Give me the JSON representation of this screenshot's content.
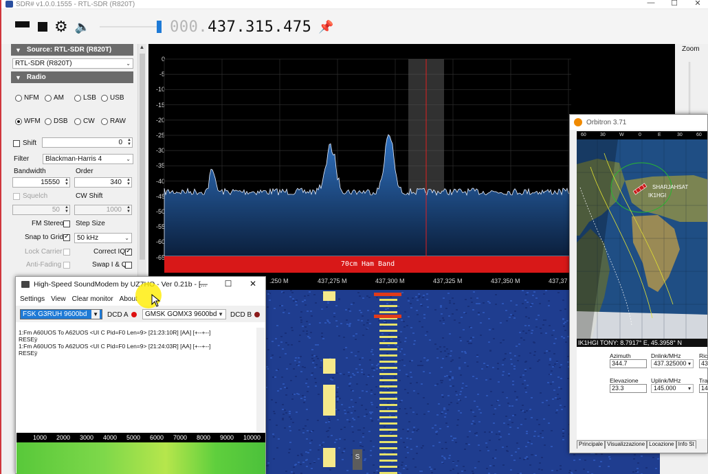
{
  "window": {
    "title": "SDR# v1.0.0.1555 - RTL-SDR (R820T)",
    "controls": [
      "—",
      "☐",
      "✕"
    ]
  },
  "toolbar": {
    "freq_dim": "000.",
    "freq_value": "437.315.475",
    "volume_level": 1.0
  },
  "source": {
    "header": "Source: RTL-SDR (R820T)",
    "device": "RTL-SDR (R820T)"
  },
  "radio": {
    "header": "Radio",
    "modes": [
      {
        "label": "NFM",
        "on": false
      },
      {
        "label": "AM",
        "on": false
      },
      {
        "label": "LSB",
        "on": false
      },
      {
        "label": "USB",
        "on": false
      },
      {
        "label": "WFM",
        "on": true
      },
      {
        "label": "DSB",
        "on": false
      },
      {
        "label": "CW",
        "on": false
      },
      {
        "label": "RAW",
        "on": false
      }
    ],
    "shift_label": "Shift",
    "shift_value": "0",
    "filter_label": "Filter",
    "filter_value": "Blackman-Harris 4",
    "bandwidth_label": "Bandwidth",
    "bandwidth_value": "15550",
    "order_label": "Order",
    "order_value": "340",
    "squelch_label": "Squelch",
    "squelch_value": "50",
    "cwshift_label": "CW Shift",
    "cwshift_value": "1000",
    "fmstereo_label": "FM Stereo",
    "stepsize_label": "Step Size",
    "snap_label": "Snap to Grid",
    "step_value": "50 kHz",
    "lockcarrier_label": "Lock Carrier",
    "correctiq_label": "Correct IQ",
    "antifading_label": "Anti-Fading",
    "swapiq_label": "Swap I & Q"
  },
  "spectrum": {
    "y_ticks": [
      "0",
      "-5",
      "-10",
      "-15",
      "-20",
      "-25",
      "-30",
      "-35",
      "-40",
      "-45",
      "-50",
      "-55",
      "-60",
      "-65"
    ],
    "x_ticks": [
      ".250 M",
      "437,275 M",
      "437,300 M",
      "437,325 M",
      "437,350 M",
      "437,37"
    ],
    "band_label": "70cm Ham Band",
    "zoom_label": "Zoom"
  },
  "soundmodem": {
    "title": "High-Speed SoundModem by UZ7HO - Ver 0.21b - [...",
    "menu": [
      "Settings",
      "View",
      "Clear monitor",
      "About"
    ],
    "mode_a": "FSK G3RUH 9600bd",
    "dcd_a": "DCD A",
    "mode_b": "GMSK GOMX3 9600bd",
    "dcd_b": "DCD B",
    "log": [
      "1:Fm A60UOS To A62UOS <UI C Pid=F0 Len=9> [21:23:10R] [AA] [+--+--]",
      "RESEÿ",
      "1:Fm A60UOS To A62UOS <UI C Pid=F0 Len=9> [21:24:03R] [AA] [+--+--]",
      "RESEÿ"
    ],
    "axis": [
      "1000",
      "2000",
      "3000",
      "4000",
      "5000",
      "6000",
      "7000",
      "8000",
      "9000",
      "10000"
    ]
  },
  "orbitron": {
    "title": "Orbitron 3.71",
    "ruler": [
      "60",
      "30",
      "W",
      "0",
      "E",
      "30",
      "60"
    ],
    "sat_label": "SHARJAHSAT",
    "station_label": "IK1HGI",
    "status": "IK1HGI TONY: 8.7917° E, 45.3958° N",
    "azimuth_label": "Azimuth",
    "azimuth_value": "344.7",
    "dnlink_label": "Dnlink/MHz",
    "dnlink_value": "437.325000",
    "elev_label": "Elevazione",
    "elev_value": "23.3",
    "uplink_label": "Uplink/MHz",
    "uplink_value": "145.000",
    "extra_1": "Ric",
    "extra_2": "Tra",
    "extra_v1": "43",
    "extra_v2": "14",
    "tabs": [
      "Principale",
      "Visualizzazione",
      "Locazione",
      "Info St"
    ]
  },
  "colors": {
    "accent_blue": "#1e7ad6",
    "band_red": "#d81818",
    "spectrum_fill": "#1e5aa8"
  }
}
